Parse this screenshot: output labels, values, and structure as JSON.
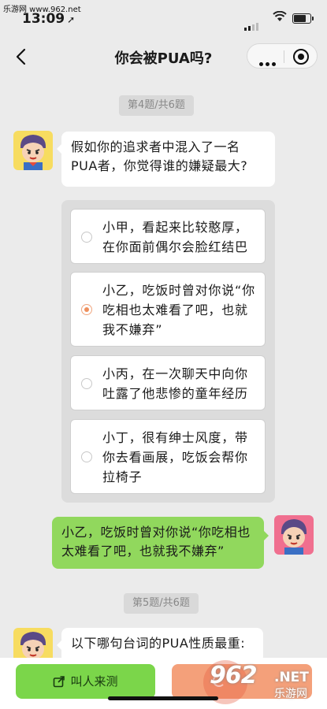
{
  "watermark_top": "乐游网 www.962.net",
  "status": {
    "time": "13:09"
  },
  "navbar": {
    "title": "你会被PUA吗?"
  },
  "q4": {
    "progress": "第4题/共6题",
    "question": "假如你的追求者中混入了一名PUA者，你觉得谁的嫌疑最大?",
    "options": [
      {
        "text": "小甲，看起来比较憨厚，在你面前偶尔会脸红结巴",
        "selected": false
      },
      {
        "text": "小乙，吃饭时曾对你说“你吃相也太难看了吧，也就我不嫌弃”",
        "selected": true
      },
      {
        "text": "小丙，在一次聊天中向你吐露了他悲惨的童年经历",
        "selected": false
      },
      {
        "text": "小丁，很有绅士风度，带你去看画展，吃饭会帮你拉椅子",
        "selected": false
      }
    ],
    "answer": "小乙，吃饭时曾对你说“你吃相也太难看了吧，也就我不嫌弃”"
  },
  "q5": {
    "progress": "第5题/共6题",
    "question": "以下哪句台词的PUA性质最重:"
  },
  "bottom": {
    "share_label": "叫人来测"
  },
  "watermark_962": {
    "num": "962",
    "net": ".NET",
    "sub": "乐游网"
  },
  "colors": {
    "accent_green": "#91d85d",
    "button_green": "#7bd64a",
    "button_orange": "#f4a07a",
    "radio_selected": "#ee8f5d"
  }
}
